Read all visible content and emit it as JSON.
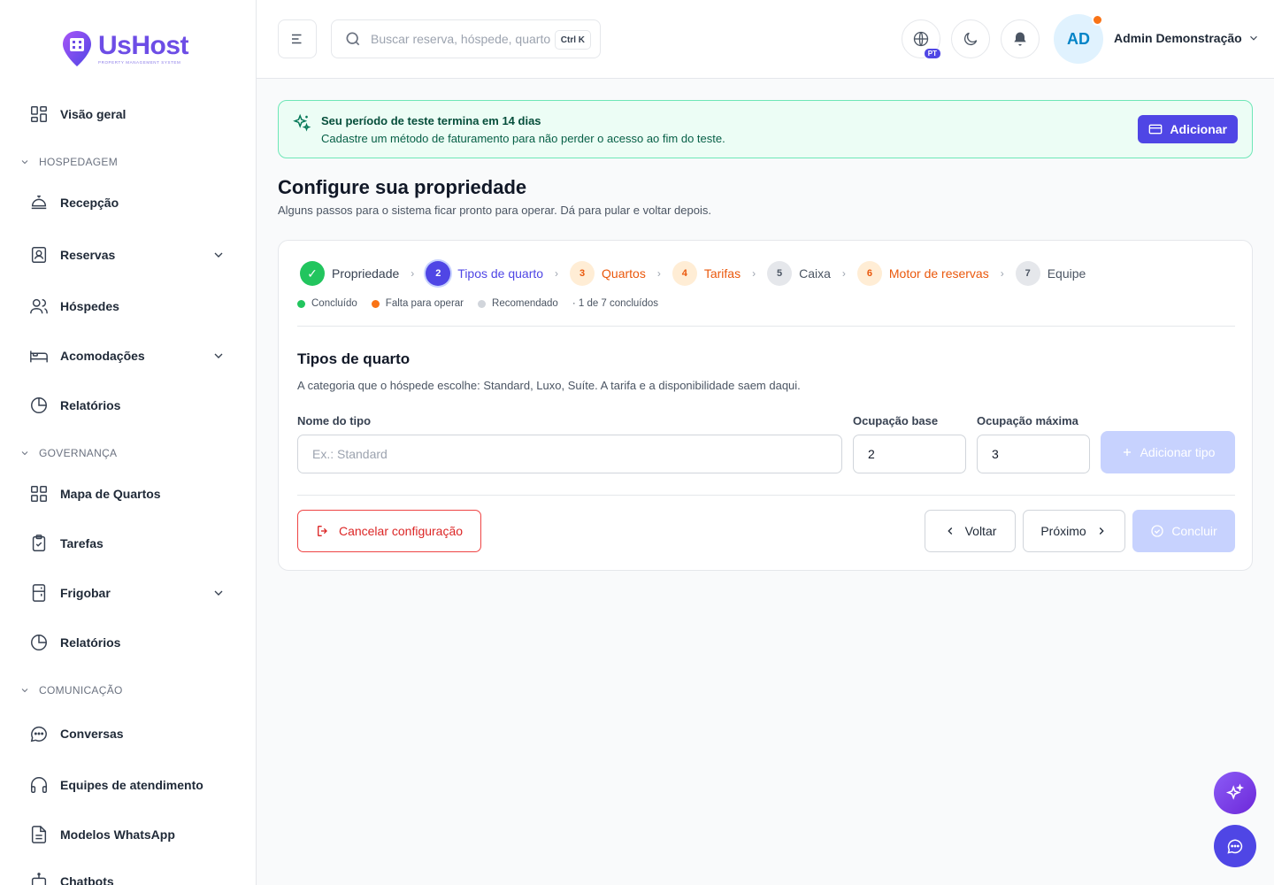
{
  "brand": {
    "name": "UsHost",
    "tagline": "PROPERTY MANAGEMENT SYSTEM"
  },
  "sidebar": {
    "overview": "Visão geral",
    "sections": [
      {
        "label": "HOSPEDAGEM"
      },
      {
        "label": "GOVERNANÇA"
      },
      {
        "label": "COMUNICAÇÃO"
      }
    ],
    "items": [
      {
        "label": "Recepção"
      },
      {
        "label": "Reservas"
      },
      {
        "label": "Hóspedes"
      },
      {
        "label": "Acomodações"
      },
      {
        "label": "Relatórios"
      },
      {
        "label": "Mapa de Quartos"
      },
      {
        "label": "Tarefas"
      },
      {
        "label": "Frigobar"
      },
      {
        "label": "Relatórios"
      },
      {
        "label": "Conversas"
      },
      {
        "label": "Equipes de atendimento"
      },
      {
        "label": "Modelos WhatsApp"
      },
      {
        "label": "Chatbots"
      }
    ]
  },
  "header": {
    "search_placeholder": "Buscar reserva, hóspede, quarto…",
    "search_shortcut": "Ctrl K",
    "language_badge": "PT",
    "avatar_initials": "AD",
    "user_name": "Admin Demonstração"
  },
  "banner": {
    "title": "Seu período de teste termina em 14 dias",
    "text": "Cadastre um método de faturamento para não perder o acesso ao fim do teste.",
    "button": "Adicionar"
  },
  "page": {
    "title": "Configure sua propriedade",
    "subtitle": "Alguns passos para o sistema ficar pronto para operar. Dá para pular e voltar depois."
  },
  "wizard": {
    "steps": [
      {
        "number": "✓",
        "label": "Propriedade",
        "state": "done"
      },
      {
        "number": "2",
        "label": "Tipos de quarto",
        "state": "current"
      },
      {
        "number": "3",
        "label": "Quartos",
        "state": "required"
      },
      {
        "number": "4",
        "label": "Tarifas",
        "state": "required"
      },
      {
        "number": "5",
        "label": "Caixa",
        "state": "recommended"
      },
      {
        "number": "6",
        "label": "Motor de reservas",
        "state": "required"
      },
      {
        "number": "7",
        "label": "Equipe",
        "state": "recommended"
      }
    ],
    "separator": "›",
    "legend": {
      "done": "Concluído",
      "required": "Falta para operar",
      "recommended": "Recomendado",
      "progress": "· 1 de 7 concluídos"
    },
    "section_title": "Tipos de quarto",
    "section_desc": "A categoria que o hóspede escolhe: Standard, Luxo, Suíte. A tarifa e a disponibilidade saem daqui.",
    "fields": {
      "name_label": "Nome do tipo",
      "name_placeholder": "Ex.: Standard",
      "base_label": "Ocupação base",
      "base_value": "2",
      "max_label": "Ocupação máxima",
      "max_value": "3"
    },
    "add_button": "Adicionar tipo",
    "cancel_button": "Cancelar configuração",
    "back_button": "Voltar",
    "next_button": "Próximo",
    "finish_button": "Concluir"
  },
  "colors": {
    "primary": "#4f46e5",
    "done": "#22c55e",
    "required": "#f97316",
    "recommended": "#d1d5db",
    "brand": "#6d4de6"
  }
}
